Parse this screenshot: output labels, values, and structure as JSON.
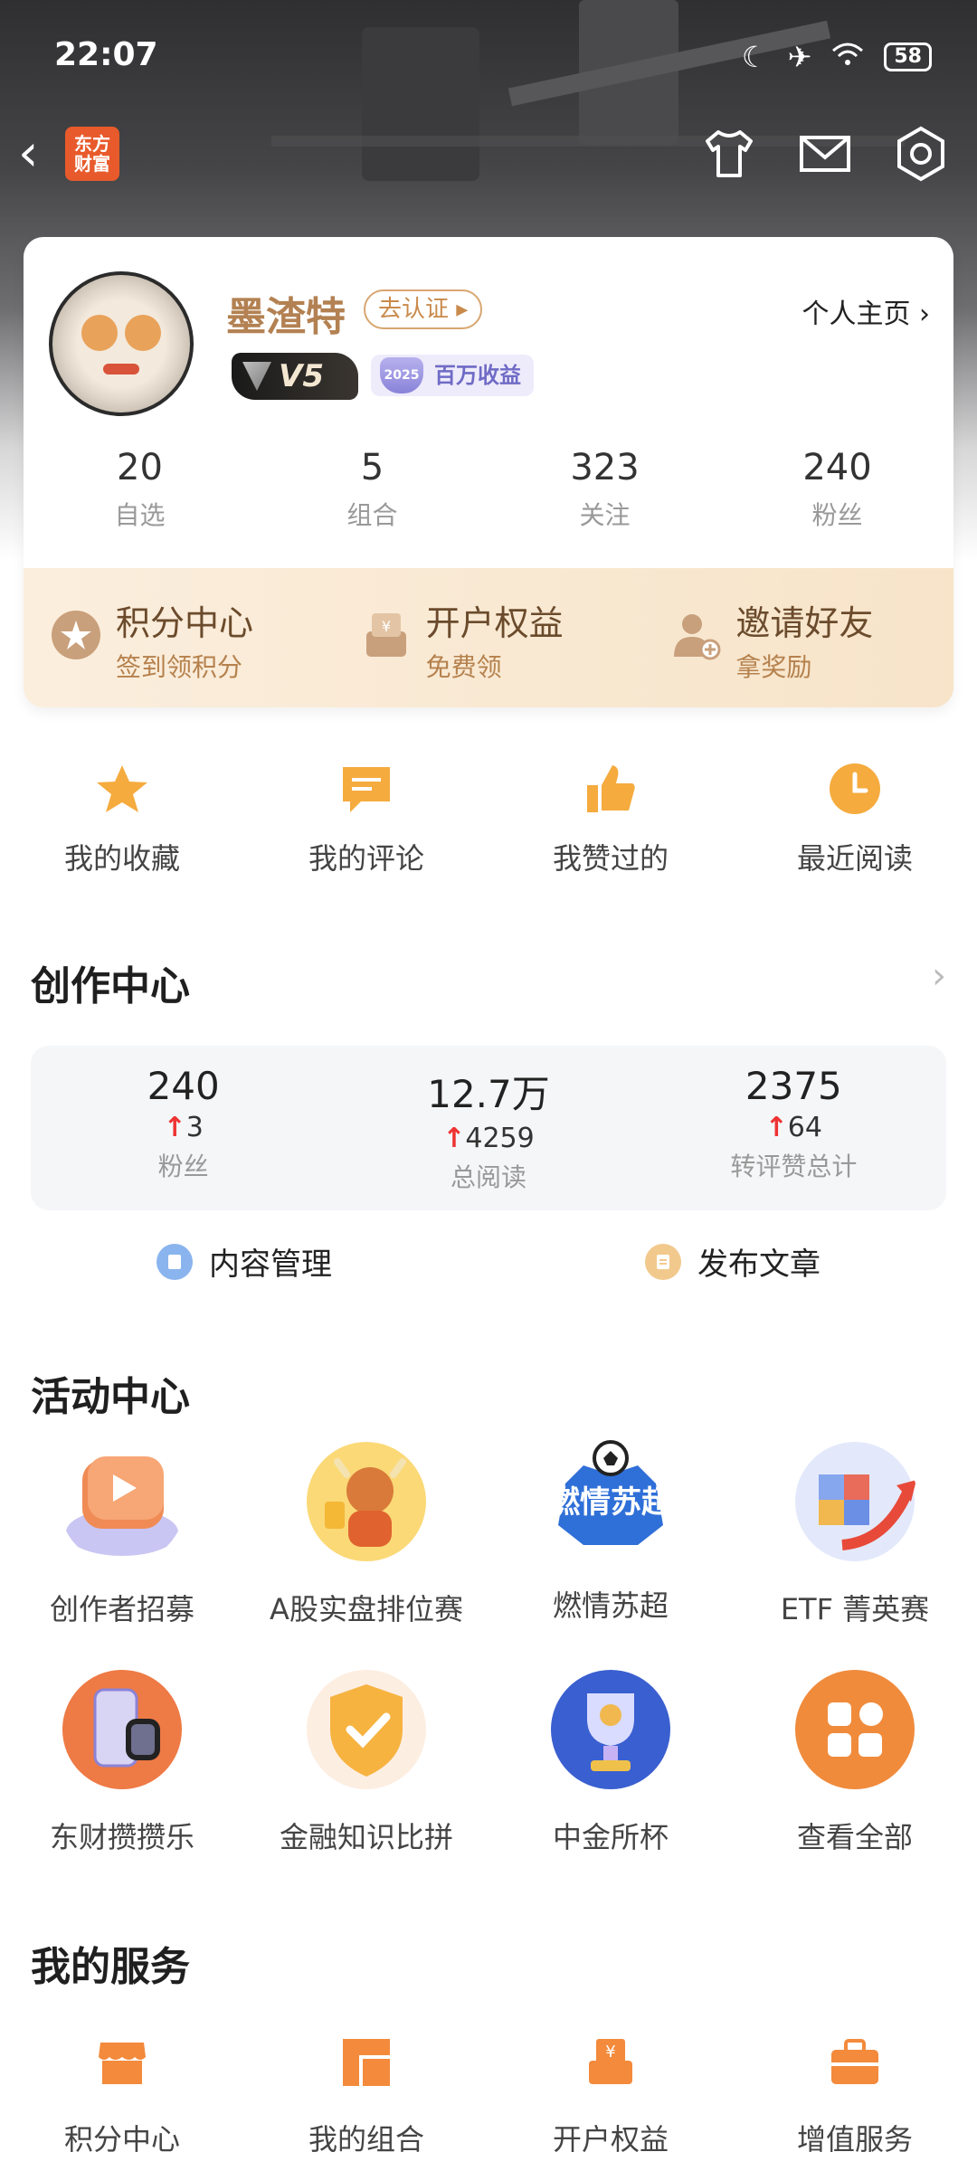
{
  "status_bar": {
    "time": "22:07",
    "battery": "58"
  },
  "app": {
    "logo_text_1": "东方",
    "logo_text_2": "财富"
  },
  "profile": {
    "username": "墨渣特",
    "verify_label": "去认证 ▸",
    "vip_level": "V5",
    "badge_year": "2025",
    "badge_text": "百万收益",
    "homepage_link": "个人主页 ›",
    "stats": [
      {
        "value": "20",
        "label": "自选"
      },
      {
        "value": "5",
        "label": "组合"
      },
      {
        "value": "323",
        "label": "关注"
      },
      {
        "value": "240",
        "label": "粉丝"
      }
    ]
  },
  "perks": [
    {
      "title": "积分中心",
      "subtitle": "签到领积分",
      "icon": "star-coin-icon"
    },
    {
      "title": "开户权益",
      "subtitle": "免费领",
      "icon": "yuan-box-icon"
    },
    {
      "title": "邀请好友",
      "subtitle": "拿奖励",
      "icon": "add-user-icon"
    }
  ],
  "quick_links": [
    {
      "label": "我的收藏",
      "icon": "star-icon"
    },
    {
      "label": "我的评论",
      "icon": "comment-icon"
    },
    {
      "label": "我赞过的",
      "icon": "thumb-up-icon"
    },
    {
      "label": "最近阅读",
      "icon": "clock-icon"
    }
  ],
  "creator_center": {
    "title": "创作中心",
    "stats": [
      {
        "value": "240",
        "increase": "3",
        "label": "粉丝"
      },
      {
        "value": "12.7万",
        "increase": "4259",
        "label": "总阅读"
      },
      {
        "value": "2375",
        "increase": "64",
        "label": "转评赞总计"
      }
    ],
    "actions": [
      {
        "label": "内容管理",
        "icon": "book-icon",
        "color": "#8ab4ee"
      },
      {
        "label": "发布文章",
        "icon": "document-icon",
        "color": "#f2c98d"
      }
    ]
  },
  "activity_center": {
    "title": "活动中心",
    "items": [
      {
        "label": "创作者招募",
        "icon": "play-cube-icon"
      },
      {
        "label": "A股实盘排位赛",
        "icon": "bull-mascot-icon"
      },
      {
        "label": "燃情苏超",
        "icon": "soccer-badge-icon",
        "badge_text": "燃情苏超"
      },
      {
        "label": "ETF 菁英赛",
        "icon": "cube-arrow-icon"
      },
      {
        "label": "东财攒攒乐",
        "icon": "gadgets-icon"
      },
      {
        "label": "金融知识比拼",
        "icon": "check-shield-icon"
      },
      {
        "label": "中金所杯",
        "icon": "trophy-icon"
      },
      {
        "label": "查看全部",
        "icon": "grid-icon"
      }
    ]
  },
  "my_services": {
    "title": "我的服务",
    "items": [
      {
        "label": "积分中心",
        "icon": "shop-icon"
      },
      {
        "label": "我的组合",
        "icon": "portfolio-icon"
      },
      {
        "label": "开户权益",
        "icon": "yuan-box-icon"
      },
      {
        "label": "增值服务",
        "icon": "briefcase-icon"
      }
    ]
  },
  "colors": {
    "accent": "#f39a3a",
    "brand": "#e85a2b",
    "up": "#e33333"
  }
}
